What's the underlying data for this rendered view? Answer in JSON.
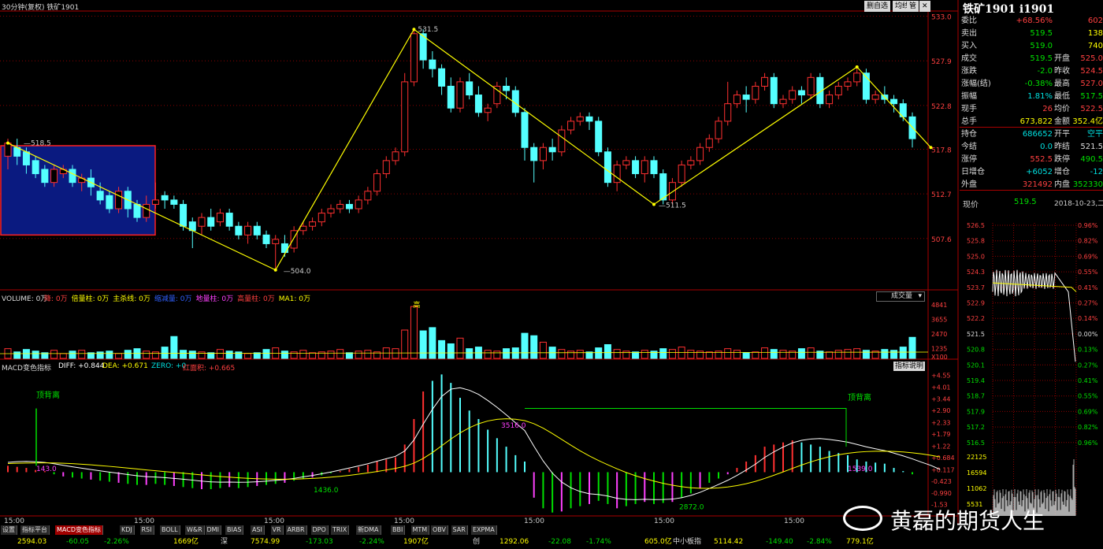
{
  "header": {
    "title": "30分钟(复权) 铁矿1901",
    "buttons": [
      "删自选",
      "均线",
      "管"
    ]
  },
  "main": {
    "price_axis": [
      "533.0",
      "527.9",
      "522.8",
      "517.8",
      "512.7",
      "507.6"
    ],
    "annotations": {
      "p1": "518.5",
      "p2": "531.5",
      "p3": "504.0",
      "p4": "511.5"
    },
    "candles": [
      {
        "o": 517.0,
        "c": 518.5,
        "h": 519.0,
        "l": 515.5
      },
      {
        "o": 518.0,
        "c": 517.0,
        "h": 519.0,
        "l": 516.0
      },
      {
        "o": 517.5,
        "c": 516.0,
        "h": 518.0,
        "l": 515.0
      },
      {
        "o": 516.5,
        "c": 515.0,
        "h": 517.0,
        "l": 514.5
      },
      {
        "o": 515.5,
        "c": 514.0,
        "h": 516.0,
        "l": 513.5
      },
      {
        "o": 514.0,
        "c": 515.5,
        "h": 516.0,
        "l": 513.5
      },
      {
        "o": 515.0,
        "c": 515.5,
        "h": 516.0,
        "l": 514.5
      },
      {
        "o": 515.5,
        "c": 514.0,
        "h": 516.0,
        "l": 513.5
      },
      {
        "o": 514.0,
        "c": 514.5,
        "h": 515.0,
        "l": 513.0
      },
      {
        "o": 514.5,
        "c": 513.5,
        "h": 515.5,
        "l": 512.5
      },
      {
        "o": 513.0,
        "c": 512.0,
        "h": 514.0,
        "l": 511.5
      },
      {
        "o": 512.5,
        "c": 511.0,
        "h": 513.0,
        "l": 510.5
      },
      {
        "o": 511.0,
        "c": 513.0,
        "h": 513.5,
        "l": 510.5
      },
      {
        "o": 513.0,
        "c": 511.0,
        "h": 513.5,
        "l": 510.0
      },
      {
        "o": 511.5,
        "c": 510.0,
        "h": 512.0,
        "l": 509.5
      },
      {
        "o": 510.0,
        "c": 511.5,
        "h": 512.5,
        "l": 509.5
      },
      {
        "o": 511.5,
        "c": 512.0,
        "h": 514.0,
        "l": 511.0
      },
      {
        "o": 512.5,
        "c": 512.0,
        "h": 513.0,
        "l": 511.0
      },
      {
        "o": 512.0,
        "c": 511.5,
        "h": 512.5,
        "l": 511.0
      },
      {
        "o": 511.5,
        "c": 509.0,
        "h": 512.0,
        "l": 508.5
      },
      {
        "o": 509.5,
        "c": 508.5,
        "h": 510.0,
        "l": 506.5
      },
      {
        "o": 509.0,
        "c": 510.0,
        "h": 510.5,
        "l": 508.0
      },
      {
        "o": 510.0,
        "c": 509.0,
        "h": 511.0,
        "l": 508.5
      },
      {
        "o": 509.5,
        "c": 510.5,
        "h": 511.0,
        "l": 509.0
      },
      {
        "o": 510.5,
        "c": 509.0,
        "h": 511.0,
        "l": 508.5
      },
      {
        "o": 509.0,
        "c": 508.0,
        "h": 509.5,
        "l": 507.5
      },
      {
        "o": 508.0,
        "c": 509.0,
        "h": 509.5,
        "l": 507.0
      },
      {
        "o": 509.0,
        "c": 508.0,
        "h": 509.5,
        "l": 507.5
      },
      {
        "o": 508.0,
        "c": 507.0,
        "h": 508.5,
        "l": 506.5
      },
      {
        "o": 507.0,
        "c": 507.5,
        "h": 508.0,
        "l": 504.0
      },
      {
        "o": 507.0,
        "c": 506.0,
        "h": 508.0,
        "l": 505.5
      },
      {
        "o": 506.5,
        "c": 508.5,
        "h": 509.0,
        "l": 506.0
      },
      {
        "o": 508.5,
        "c": 509.0,
        "h": 509.5,
        "l": 508.0
      },
      {
        "o": 509.0,
        "c": 509.5,
        "h": 510.0,
        "l": 508.5
      },
      {
        "o": 509.5,
        "c": 510.5,
        "h": 511.0,
        "l": 509.0
      },
      {
        "o": 510.5,
        "c": 511.0,
        "h": 511.5,
        "l": 510.0
      },
      {
        "o": 511.0,
        "c": 511.5,
        "h": 512.0,
        "l": 510.5
      },
      {
        "o": 511.5,
        "c": 511.0,
        "h": 512.0,
        "l": 510.5
      },
      {
        "o": 511.0,
        "c": 512.0,
        "h": 512.5,
        "l": 510.5
      },
      {
        "o": 512.0,
        "c": 513.0,
        "h": 513.5,
        "l": 511.5
      },
      {
        "o": 513.0,
        "c": 515.0,
        "h": 515.5,
        "l": 512.5
      },
      {
        "o": 515.0,
        "c": 516.5,
        "h": 517.0,
        "l": 514.5
      },
      {
        "o": 516.5,
        "c": 517.5,
        "h": 518.0,
        "l": 516.0
      },
      {
        "o": 517.5,
        "c": 525.5,
        "h": 526.5,
        "l": 517.0
      },
      {
        "o": 525.5,
        "c": 531.0,
        "h": 531.5,
        "l": 525.0
      },
      {
        "o": 531.0,
        "c": 528.0,
        "h": 531.5,
        "l": 527.0
      },
      {
        "o": 528.0,
        "c": 527.0,
        "h": 529.0,
        "l": 526.0
      },
      {
        "o": 527.0,
        "c": 525.0,
        "h": 527.5,
        "l": 524.0
      },
      {
        "o": 525.0,
        "c": 522.5,
        "h": 526.0,
        "l": 522.0
      },
      {
        "o": 522.5,
        "c": 525.5,
        "h": 526.0,
        "l": 522.0
      },
      {
        "o": 525.5,
        "c": 524.0,
        "h": 526.5,
        "l": 523.5
      },
      {
        "o": 524.0,
        "c": 522.0,
        "h": 525.0,
        "l": 521.5
      },
      {
        "o": 522.0,
        "c": 522.5,
        "h": 523.0,
        "l": 521.0
      },
      {
        "o": 523.0,
        "c": 525.0,
        "h": 525.5,
        "l": 522.5
      },
      {
        "o": 525.0,
        "c": 524.5,
        "h": 526.0,
        "l": 523.5
      },
      {
        "o": 524.5,
        "c": 522.0,
        "h": 525.0,
        "l": 521.5
      },
      {
        "o": 522.0,
        "c": 518.0,
        "h": 522.5,
        "l": 516.5
      },
      {
        "o": 518.0,
        "c": 516.5,
        "h": 518.5,
        "l": 514.0
      },
      {
        "o": 516.5,
        "c": 518.0,
        "h": 518.5,
        "l": 515.5
      },
      {
        "o": 518.0,
        "c": 517.5,
        "h": 519.0,
        "l": 516.5
      },
      {
        "o": 517.5,
        "c": 520.0,
        "h": 520.5,
        "l": 517.0
      },
      {
        "o": 520.0,
        "c": 521.0,
        "h": 521.5,
        "l": 519.5
      },
      {
        "o": 521.0,
        "c": 521.5,
        "h": 522.0,
        "l": 520.5
      },
      {
        "o": 521.5,
        "c": 521.0,
        "h": 522.0,
        "l": 520.0
      },
      {
        "o": 521.0,
        "c": 517.5,
        "h": 521.5,
        "l": 517.0
      },
      {
        "o": 517.5,
        "c": 514.0,
        "h": 518.0,
        "l": 513.5
      },
      {
        "o": 514.0,
        "c": 516.0,
        "h": 516.5,
        "l": 513.0
      },
      {
        "o": 516.0,
        "c": 516.5,
        "h": 517.0,
        "l": 515.5
      },
      {
        "o": 516.5,
        "c": 515.0,
        "h": 517.0,
        "l": 514.5
      },
      {
        "o": 515.0,
        "c": 516.5,
        "h": 517.0,
        "l": 514.0
      },
      {
        "o": 516.5,
        "c": 515.0,
        "h": 517.0,
        "l": 514.5
      },
      {
        "o": 515.0,
        "c": 512.0,
        "h": 515.5,
        "l": 511.5
      },
      {
        "o": 512.0,
        "c": 514.0,
        "h": 514.5,
        "l": 511.5
      },
      {
        "o": 514.0,
        "c": 516.0,
        "h": 516.5,
        "l": 513.5
      },
      {
        "o": 516.0,
        "c": 516.5,
        "h": 517.0,
        "l": 515.5
      },
      {
        "o": 516.5,
        "c": 518.0,
        "h": 518.5,
        "l": 516.0
      },
      {
        "o": 518.0,
        "c": 519.0,
        "h": 519.5,
        "l": 517.5
      },
      {
        "o": 519.0,
        "c": 521.0,
        "h": 521.5,
        "l": 518.5
      },
      {
        "o": 521.0,
        "c": 523.0,
        "h": 525.5,
        "l": 520.5
      },
      {
        "o": 523.0,
        "c": 524.0,
        "h": 524.5,
        "l": 522.5
      },
      {
        "o": 524.0,
        "c": 523.5,
        "h": 525.0,
        "l": 522.0
      },
      {
        "o": 523.5,
        "c": 525.0,
        "h": 525.5,
        "l": 523.0
      },
      {
        "o": 525.0,
        "c": 526.0,
        "h": 526.5,
        "l": 524.5
      },
      {
        "o": 526.0,
        "c": 523.0,
        "h": 526.5,
        "l": 522.5
      },
      {
        "o": 523.0,
        "c": 523.5,
        "h": 524.0,
        "l": 522.5
      },
      {
        "o": 523.5,
        "c": 524.5,
        "h": 525.0,
        "l": 523.0
      },
      {
        "o": 524.5,
        "c": 524.0,
        "h": 525.0,
        "l": 523.0
      },
      {
        "o": 524.0,
        "c": 526.0,
        "h": 526.5,
        "l": 523.5
      },
      {
        "o": 526.0,
        "c": 523.0,
        "h": 526.5,
        "l": 522.5
      },
      {
        "o": 523.0,
        "c": 524.0,
        "h": 524.5,
        "l": 522.5
      },
      {
        "o": 524.0,
        "c": 525.0,
        "h": 525.5,
        "l": 523.5
      },
      {
        "o": 525.0,
        "c": 525.5,
        "h": 526.0,
        "l": 524.5
      },
      {
        "o": 525.5,
        "c": 526.5,
        "h": 527.0,
        "l": 525.0
      },
      {
        "o": 526.5,
        "c": 523.5,
        "h": 527.0,
        "l": 523.0
      },
      {
        "o": 523.5,
        "c": 524.0,
        "h": 524.5,
        "l": 523.0
      },
      {
        "o": 524.0,
        "c": 523.5,
        "h": 525.0,
        "l": 523.0
      },
      {
        "o": 523.5,
        "c": 523.0,
        "h": 524.0,
        "l": 522.0
      },
      {
        "o": 523.0,
        "c": 521.5,
        "h": 523.5,
        "l": 521.0
      },
      {
        "o": 521.5,
        "c": 519.0,
        "h": 522.0,
        "l": 518.0
      }
    ]
  },
  "volume": {
    "label": "VOLUME: 0万",
    "items": [
      "降: 0万",
      "倍量柱: 0万",
      "主杀线: 0万",
      "缩减量: 0万",
      "地量柱: 0万",
      "高量柱: 0万",
      "MA1: 0万"
    ],
    "select": "成交量",
    "axis": [
      "4841",
      "3655",
      "2470",
      "1235"
    ],
    "multiplier": "X100",
    "tag": "高",
    "bars": [
      12,
      8,
      11,
      9,
      7,
      10,
      6,
      9,
      10,
      7,
      8,
      9,
      6,
      10,
      12,
      9,
      8,
      14,
      27,
      10,
      9,
      8,
      7,
      11,
      9,
      8,
      6,
      7,
      11,
      13,
      9,
      8,
      10,
      7,
      8,
      9,
      11,
      7,
      9,
      10,
      8,
      13,
      12,
      35,
      64,
      34,
      38,
      22,
      18,
      25,
      12,
      14,
      10,
      9,
      12,
      13,
      31,
      28,
      20,
      14,
      11,
      9,
      10,
      8,
      13,
      17,
      11,
      9,
      8,
      10,
      9,
      12,
      11,
      14,
      10,
      9,
      8,
      9,
      12,
      10,
      7,
      8,
      13,
      11,
      10,
      9,
      12,
      13,
      9,
      8,
      10,
      11,
      12,
      10,
      9,
      11,
      10,
      14,
      26
    ]
  },
  "macd": {
    "title": "MACD变色指标",
    "diff": "DIFF: +0.844",
    "dea": "DEA: +0.671",
    "zero": "ZERO: +0",
    "area": "红面积: +0.665",
    "button": "指标说明",
    "axis": [
      "4.55",
      "4.01",
      "3.44",
      "2.90",
      "2.33",
      "1.79",
      "1.22",
      "0.684",
      "0.117",
      "-0.423",
      "-0.990",
      "-1.53"
    ],
    "annotations": {
      "a1": "顶背离",
      "a2": "顶背离",
      "n1": "143.0",
      "n2": "1436.0",
      "n3": "3516.0",
      "n4": "2872.0",
      "n5": "1539.0"
    },
    "hist": [
      0.3,
      0.25,
      0.2,
      0.1,
      0.05,
      -0.1,
      -0.2,
      -0.25,
      -0.3,
      -0.35,
      -0.4,
      -0.45,
      -0.5,
      -0.55,
      -0.6,
      -0.6,
      -0.55,
      -0.6,
      -0.65,
      -0.7,
      -0.75,
      -0.8,
      -0.8,
      -0.75,
      -0.7,
      -0.75,
      -0.7,
      -0.65,
      -0.6,
      -0.55,
      -0.5,
      -0.4,
      -0.3,
      -0.25,
      -0.15,
      -0.05,
      0.05,
      0.15,
      0.25,
      0.35,
      0.5,
      0.6,
      0.7,
      1.3,
      2.5,
      3.8,
      4.3,
      4.6,
      4.2,
      3.5,
      2.9,
      2.5,
      2.0,
      1.6,
      1.2,
      0.8,
      0.5,
      -1.2,
      -1.7,
      -1.9,
      -1.85,
      -1.7,
      -1.6,
      -1.5,
      -1.35,
      -1.5,
      -1.7,
      -1.6,
      -1.5,
      -1.4,
      -1.5,
      -1.45,
      -1.4,
      -1.2,
      -1.0,
      -0.75,
      -0.5,
      -0.3,
      -0.1,
      0.2,
      0.5,
      0.8,
      1.2,
      1.3,
      1.4,
      1.5,
      1.4,
      1.3,
      1.2,
      1.0,
      0.9,
      0.8,
      0.6,
      0.5,
      0.45,
      0.4,
      0.2,
      0.05,
      -0.1,
      -0.3,
      -0.4,
      -0.7
    ]
  },
  "time_axis": [
    "15:00",
    "15:00",
    "15:00",
    "15:00",
    "15:00",
    "15:00",
    "15:00"
  ],
  "quote": {
    "title": "铁矿1901 i1901",
    "rows": [
      {
        "l": "委比",
        "v": "+68.56%",
        "r": "",
        "rv": "602",
        "vc": "#ff4040",
        "rc": "#ff4040"
      },
      {
        "l": "卖出",
        "v": "519.5",
        "r": "",
        "rv": "138",
        "vc": "#00e000",
        "rc": "#ffff00"
      },
      {
        "l": "买入",
        "v": "519.0",
        "r": "",
        "rv": "740",
        "vc": "#00e000",
        "rc": "#ffff00"
      },
      {
        "l": "成交",
        "v": "519.5",
        "r": "开盘",
        "rv": "525.0",
        "vc": "#00e000",
        "rc": "#ff4040"
      },
      {
        "l": "涨跌",
        "v": "-2.0",
        "r": "昨收",
        "rv": "524.5",
        "vc": "#00e000",
        "rc": "#ff4040"
      },
      {
        "l": "涨幅(结)",
        "v": "-0.38%",
        "r": "最高",
        "rv": "527.0",
        "vc": "#00e000",
        "rc": "#ff4040"
      },
      {
        "l": "振幅",
        "v": "1.81%",
        "r": "最低",
        "rv": "517.5",
        "vc": "#00e0e0",
        "rc": "#00e000"
      },
      {
        "l": "现手",
        "v": "26",
        "r": "均价",
        "rv": "522.5",
        "vc": "#ff4040",
        "rc": "#ff4040"
      },
      {
        "l": "总手",
        "v": "673,822",
        "r": "金额",
        "rv": "352.4亿",
        "vc": "#ffff00",
        "rc": "#ffff00"
      },
      {
        "l": "持仓",
        "v": "686652",
        "r": "开平",
        "rv": "空平",
        "vc": "#00e0e0",
        "rc": "#00e0e0"
      },
      {
        "l": "今结",
        "v": "0.0",
        "r": "昨结",
        "rv": "521.5",
        "vc": "#00e0e0",
        "rc": "#dddddd"
      },
      {
        "l": "涨停",
        "v": "552.5",
        "r": "跌停",
        "rv": "490.5",
        "vc": "#ff4040",
        "rc": "#00e000"
      },
      {
        "l": "日增仓",
        "v": "+6052",
        "r": "增仓",
        "rv": "-12",
        "vc": "#00e0e0",
        "rc": "#00e0e0"
      },
      {
        "l": "外盘",
        "v": "321492",
        "r": "内盘",
        "rv": "352330",
        "vc": "#ff4040",
        "rc": "#00e000"
      }
    ],
    "now_label": "现价",
    "now_value": "519.5",
    "date": "2018-10-23,二"
  },
  "intraday": {
    "left_axis": [
      "526.5",
      "525.8",
      "525.0",
      "524.3",
      "523.7",
      "522.9",
      "522.2",
      "521.5",
      "520.8",
      "520.1",
      "519.4",
      "518.7",
      "517.9",
      "517.2",
      "516.5"
    ],
    "right_axis": [
      "0.96%",
      "0.82%",
      "0.69%",
      "0.55%",
      "0.41%",
      "0.27%",
      "0.14%",
      "0.00%",
      "0.13%",
      "0.27%",
      "0.41%",
      "0.55%",
      "0.69%",
      "0.82%",
      "0.96%"
    ],
    "vol_axis": [
      "22125",
      "16594",
      "11062",
      "5531"
    ]
  },
  "tabs": [
    "设置",
    "指标平台",
    "MACD变色指标",
    "KDJ",
    "RSI",
    "BOLL",
    "W&R",
    "DMI",
    "BIAS",
    "ASI",
    "VR",
    "ARBR",
    "DPO",
    "TRIX",
    "新DMA",
    "BBI",
    "MTM",
    "OBV",
    "SAR",
    "EXPMA"
  ],
  "stats": [
    {
      "t": "2594.03",
      "c": "#ffff00"
    },
    {
      "t": "-60.05",
      "c": "#00e000"
    },
    {
      "t": "-2.26%",
      "c": "#00e000"
    },
    {
      "t": "1669亿",
      "c": "#ffff00"
    },
    {
      "t": "深",
      "c": "#dddddd"
    },
    {
      "t": "7574.99",
      "c": "#ffff00"
    },
    {
      "t": "-173.03",
      "c": "#00e000"
    },
    {
      "t": "-2.24%",
      "c": "#00e000"
    },
    {
      "t": "1907亿",
      "c": "#ffff00"
    },
    {
      "t": "创",
      "c": "#dddddd"
    },
    {
      "t": "1292.06",
      "c": "#ffff00"
    },
    {
      "t": "-22.08",
      "c": "#00e000"
    },
    {
      "t": "-1.74%",
      "c": "#00e000"
    },
    {
      "t": "605.0亿",
      "c": "#ffff00"
    },
    {
      "t": "中小板指",
      "c": "#dddddd"
    },
    {
      "t": "5114.42",
      "c": "#ffff00"
    },
    {
      "t": "-149.40",
      "c": "#00e000"
    },
    {
      "t": "-2.84%",
      "c": "#00e000"
    },
    {
      "t": "779.1亿",
      "c": "#ffff00"
    }
  ],
  "watermark": "黄磊的期货人生"
}
